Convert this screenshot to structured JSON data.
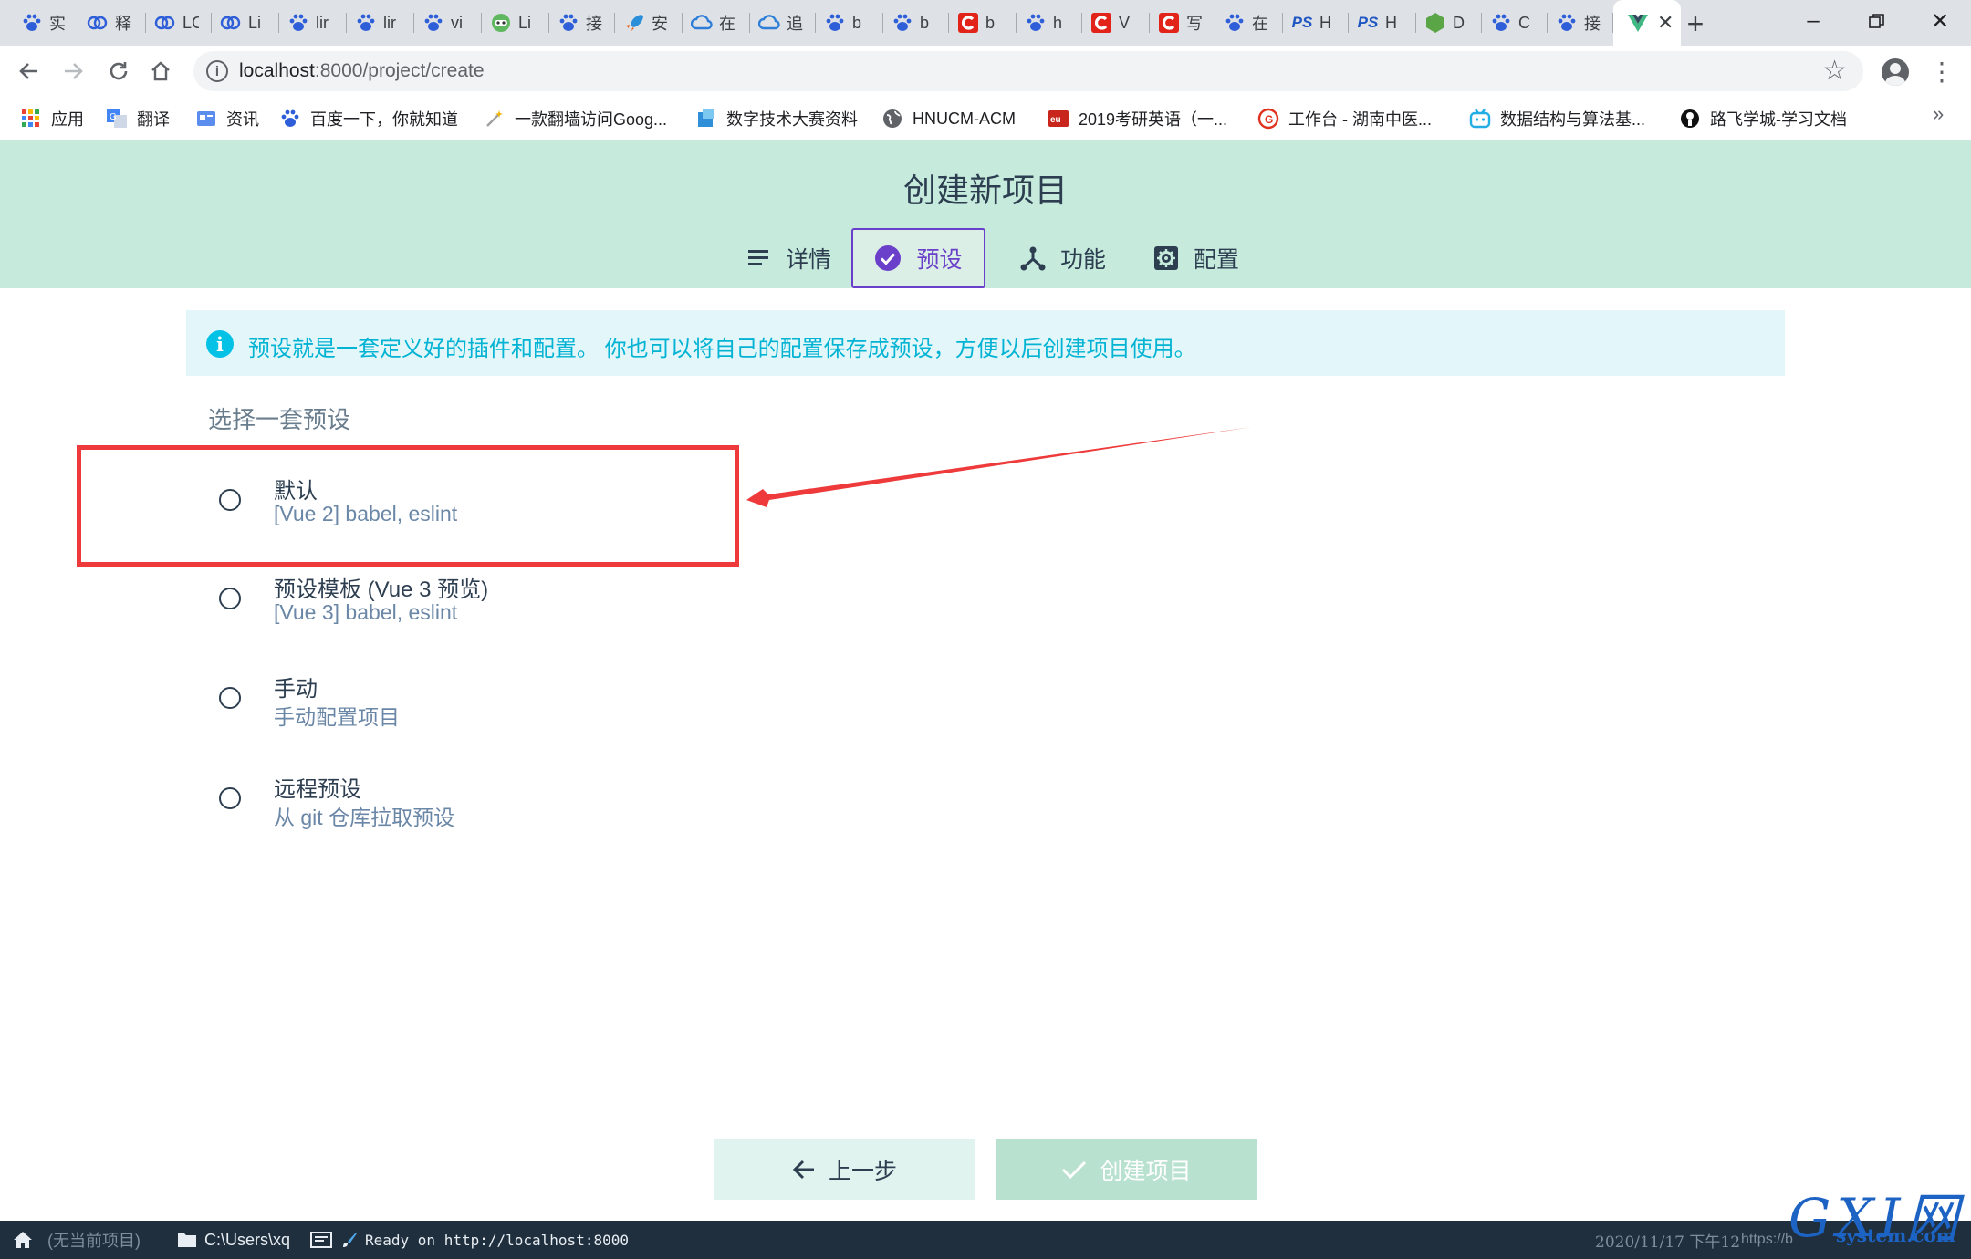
{
  "browser": {
    "tabs": [
      {
        "title": "实",
        "icon": "baidu-paw-icon"
      },
      {
        "title": "释",
        "icon": "cloud-ring-icon"
      },
      {
        "title": "LC",
        "icon": "cloud-ring-icon"
      },
      {
        "title": "Li",
        "icon": "cloud-ring-icon"
      },
      {
        "title": "lir",
        "icon": "baidu-paw-icon"
      },
      {
        "title": "lir",
        "icon": "baidu-paw-icon"
      },
      {
        "title": "vi",
        "icon": "baidu-paw-icon"
      },
      {
        "title": "Li",
        "icon": "green-face-icon"
      },
      {
        "title": "接",
        "icon": "baidu-paw-icon"
      },
      {
        "title": "安",
        "icon": "rocket-icon"
      },
      {
        "title": "在",
        "icon": "blue-cloud-icon"
      },
      {
        "title": "追",
        "icon": "blue-cloud-icon"
      },
      {
        "title": "b",
        "icon": "baidu-paw-icon"
      },
      {
        "title": "b",
        "icon": "baidu-paw-icon"
      },
      {
        "title": "b",
        "icon": "csdn-icon"
      },
      {
        "title": "h",
        "icon": "baidu-paw-icon"
      },
      {
        "title": "V",
        "icon": "csdn-icon"
      },
      {
        "title": "写",
        "icon": "csdn-icon"
      },
      {
        "title": "在",
        "icon": "baidu-paw-icon"
      },
      {
        "title": "H",
        "icon": "ps-icon"
      },
      {
        "title": "H",
        "icon": "ps-icon"
      },
      {
        "title": "D",
        "icon": "nodejs-icon"
      },
      {
        "title": "C",
        "icon": "baidu-paw-icon"
      },
      {
        "title": "接",
        "icon": "baidu-paw-icon"
      },
      {
        "title": "",
        "icon": "vue-icon",
        "active": true
      }
    ],
    "url_host": "localhost",
    "url_rest": ":8000/project/create",
    "bookmarks": [
      {
        "label": "应用",
        "icon": "apps-grid-icon"
      },
      {
        "label": "翻译",
        "icon": "translate-icon"
      },
      {
        "label": "资讯",
        "icon": "news-icon"
      },
      {
        "label": "百度一下，你就知道",
        "icon": "baidu-paw-icon"
      },
      {
        "label": "一款翻墙访问Goog...",
        "icon": "wand-icon"
      },
      {
        "label": "数字技术大赛资料",
        "icon": "cloud-doc-icon"
      },
      {
        "label": "HNUCM-ACM",
        "icon": "globe-icon"
      },
      {
        "label": "2019考研英语（一...",
        "icon": "exam-icon"
      },
      {
        "label": "工作台 - 湖南中医...",
        "icon": "workbench-icon"
      },
      {
        "label": "数据结构与算法基...",
        "icon": "bilibili-icon"
      },
      {
        "label": "路飞学城-学习文档",
        "icon": "luffy-icon"
      }
    ]
  },
  "app": {
    "title": "创建新项目",
    "steps": [
      {
        "label": "详情",
        "icon": "list-icon"
      },
      {
        "label": "预设",
        "icon": "check-circle-icon",
        "selected": true
      },
      {
        "label": "功能",
        "icon": "fork-icon"
      },
      {
        "label": "配置",
        "icon": "settings-box-icon"
      }
    ],
    "info_text": "预设就是一套定义好的插件和配置。 你也可以将自己的配置保存成预设，方便以后创建项目使用。",
    "section_title": "选择一套预设",
    "presets": [
      {
        "name": "默认",
        "desc": "[Vue 2] babel, eslint"
      },
      {
        "name": "预设模板 (Vue 3 预览)",
        "desc": "[Vue 3] babel, eslint"
      },
      {
        "name": "手动",
        "desc": "手动配置项目"
      },
      {
        "name": "远程预设",
        "desc": "从 git 仓库拉取预设"
      }
    ],
    "prev_label": "上一步",
    "create_label": "创建项目"
  },
  "statusbar": {
    "no_project": "(无当前项目)",
    "cwd": "C:\\Users\\xq",
    "log": "Ready on http://localhost:8000",
    "datetime": "2020/11/17  下午12",
    "link": "https://b"
  },
  "watermark": {
    "big": "GXI网",
    "small": "system.com"
  },
  "colors": {
    "accent": "#6a3fc9",
    "header_bg": "#c6ebdd",
    "info": "#03c2e6",
    "annotation": "#ee3a3a"
  }
}
